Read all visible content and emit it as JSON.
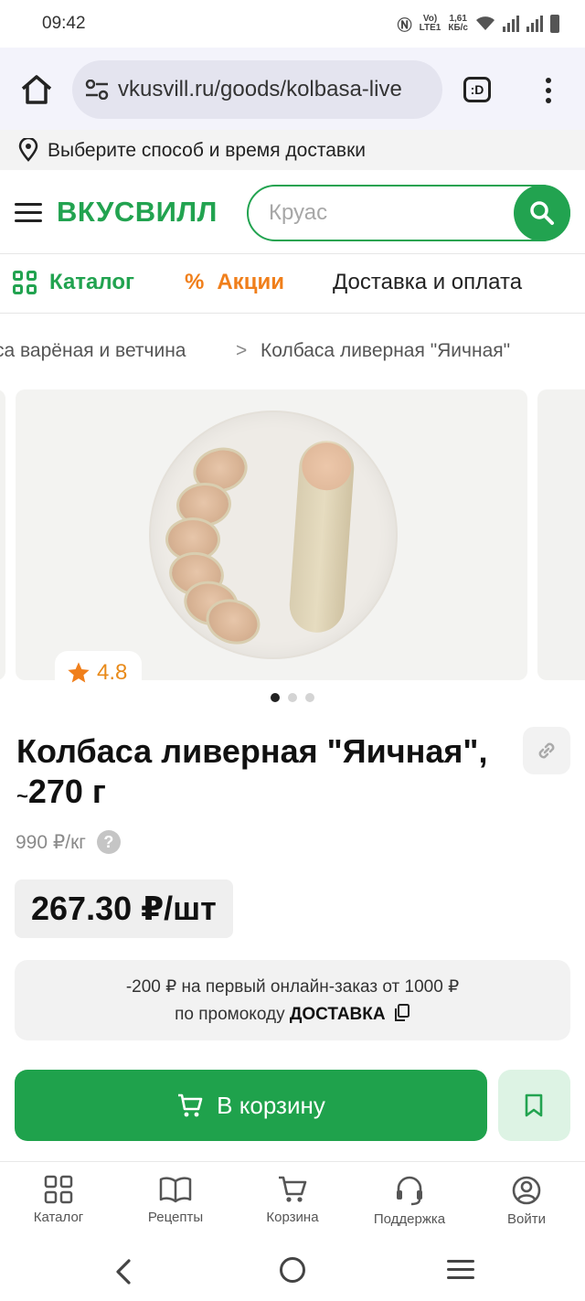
{
  "status_bar": {
    "time": "09:42",
    "net_type": "LTE1",
    "net_label": "Vo)",
    "speed_value": "1,61",
    "speed_unit": "КБ/с"
  },
  "browser": {
    "url": "vkusvill.ru/goods/kolbasa-live",
    "tabs_label": ":D"
  },
  "delivery_strip": {
    "text": "Выберите способ и время доставки"
  },
  "header": {
    "logo": "ВКУСВИЛЛ",
    "search_value": "Круас"
  },
  "nav": {
    "catalog": "Каталог",
    "promo": "Акции",
    "delivery": "Доставка и оплата",
    "promo_symbol": "%"
  },
  "breadcrumbs": {
    "parent": "са варёная и ветчина",
    "separator": ">",
    "current": "Колбаса ливерная \"Яичная\""
  },
  "gallery": {
    "rating": "4.8",
    "slides_count": 3,
    "active_slide": 0
  },
  "product": {
    "title_line1": "Колбаса ливерная \"Яичная\",",
    "title_line2": "270 г",
    "title_prefix": "~",
    "unit_price": "990 ₽/кг",
    "help_symbol": "?",
    "price": "267.30 ₽/шт"
  },
  "promo_box": {
    "line1": "-200 ₽ на первый онлайн-заказ от 1000 ₽",
    "line2_prefix": "по промокоду",
    "promocode": "ДОСТАВКА"
  },
  "actions": {
    "add_to_cart": "В корзину"
  },
  "tabbar": [
    {
      "label": "Каталог",
      "icon": "grid-icon"
    },
    {
      "label": "Рецепты",
      "icon": "book-icon"
    },
    {
      "label": "Корзина",
      "icon": "cart-icon"
    },
    {
      "label": "Поддержка",
      "icon": "headset-icon"
    },
    {
      "label": "Войти",
      "icon": "user-icon"
    }
  ],
  "colors": {
    "brand_green": "#22a350",
    "promo_orange": "#f07f1b",
    "rating_orange": "#e88a1a"
  }
}
